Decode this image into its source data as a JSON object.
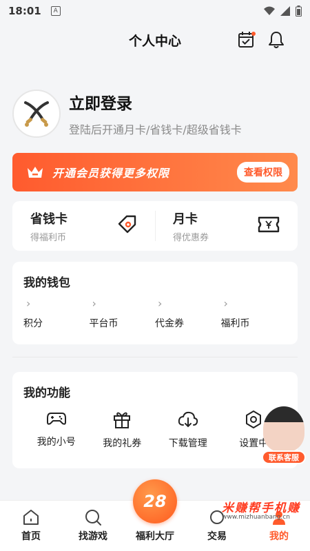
{
  "status_bar": {
    "time": "18:01",
    "notice_glyph": "A"
  },
  "header": {
    "title": "个人中心"
  },
  "profile": {
    "login_label": "立即登录",
    "subtitle": "登陆后开通月卡/省钱卡/超级省钱卡"
  },
  "vip_banner": {
    "text": "开通会员获得更多权限",
    "button_label": "查看权限"
  },
  "cards": [
    {
      "title": "省钱卡",
      "subtitle": "得福利币",
      "icon": "coupon-tag-icon"
    },
    {
      "title": "月卡",
      "subtitle": "得优惠券",
      "icon": "yen-ticket-icon"
    }
  ],
  "wallet": {
    "title": "我的钱包",
    "items": [
      {
        "label": "积分"
      },
      {
        "label": "平台币"
      },
      {
        "label": "代金券"
      },
      {
        "label": "福利币"
      }
    ]
  },
  "features": {
    "title": "我的功能",
    "items": [
      {
        "label": "我的小号",
        "icon": "gamepad-icon"
      },
      {
        "label": "我的礼券",
        "icon": "gift-icon"
      },
      {
        "label": "下载管理",
        "icon": "cloud-download-icon"
      },
      {
        "label": "设置中",
        "icon": "settings-icon"
      }
    ]
  },
  "customer_service": {
    "label": "联系客服"
  },
  "tabbar": {
    "items": [
      {
        "label": "首页",
        "icon": "home-icon"
      },
      {
        "label": "找游戏",
        "icon": "search-icon"
      },
      {
        "label": "福利大厅",
        "icon": "welfare-hall-icon"
      },
      {
        "label": "交易",
        "icon": "trade-icon"
      },
      {
        "label": "我的",
        "icon": "user-icon"
      }
    ],
    "center_badge": "28"
  },
  "watermark": {
    "line1": "米赚帮手机赚",
    "line2": "www.mizhuanbang.cn"
  },
  "colors": {
    "accent": "#ff5a2b",
    "background": "#f4f5f7"
  }
}
